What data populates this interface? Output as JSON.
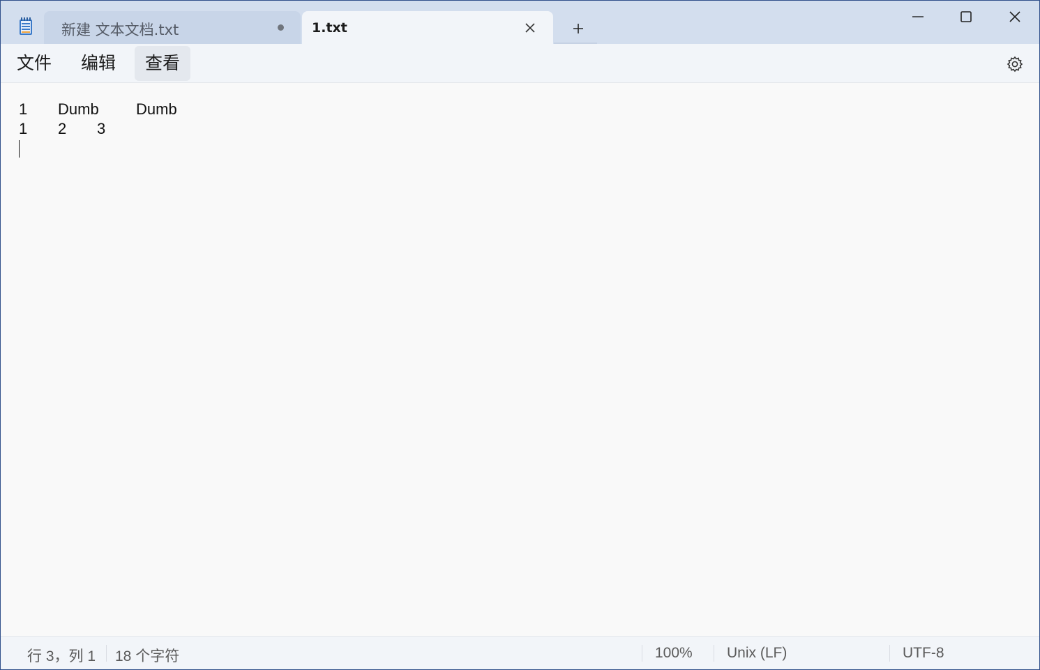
{
  "window": {
    "tabs": [
      {
        "title": "新建 文本文档.txt",
        "unsaved": true,
        "active": false
      },
      {
        "title": "1.txt",
        "active": true
      }
    ],
    "new_tab_label": "+"
  },
  "menu": {
    "file": "文件",
    "edit": "编辑",
    "view": "查看"
  },
  "editor": {
    "lines": [
      [
        "1",
        "Dumb",
        "Dumb"
      ],
      [
        "1",
        "2",
        "3"
      ]
    ]
  },
  "status": {
    "position": "行 3，列 1",
    "char_count": "18 个字符",
    "zoom": "100%",
    "line_ending": "Unix (LF)",
    "encoding": "UTF-8"
  },
  "colors": {
    "titlebar": "#d3deee",
    "menubar": "#f2f5f9",
    "editor_bg": "#f9f9f9",
    "window_border": "#2f4f8a"
  }
}
